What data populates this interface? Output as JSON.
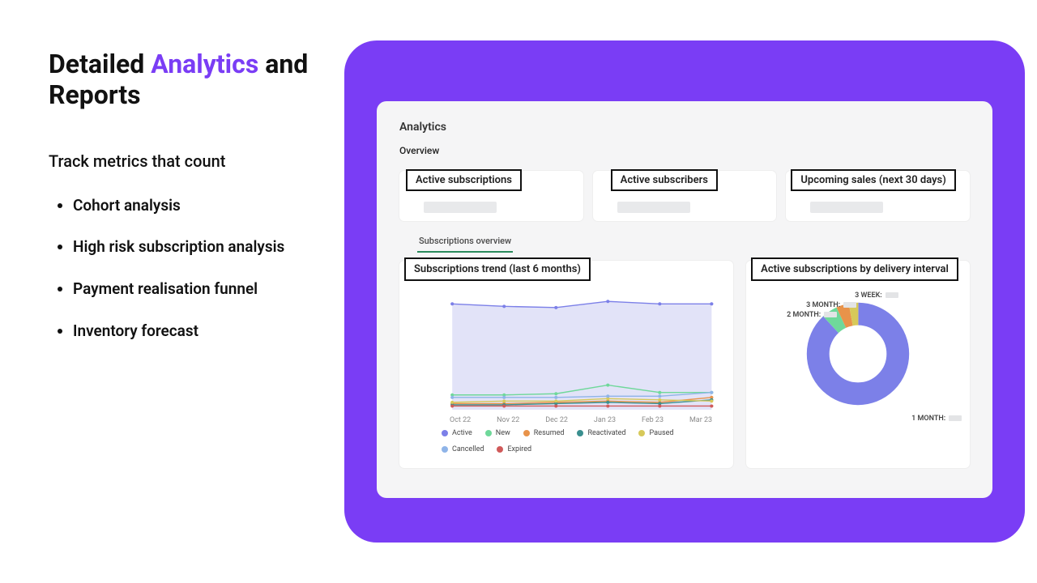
{
  "headline": {
    "pre": "Detailed ",
    "accent": "Analytics",
    "post": " and Reports"
  },
  "subhead": "Track metrics that count",
  "bullets": [
    "Cohort analysis",
    "High risk subscription analysis",
    "Payment realisation funnel",
    "Inventory forecast"
  ],
  "dashboard": {
    "title": "Analytics",
    "subtitle": "Overview",
    "kpis": [
      {
        "label": "Active subscriptions"
      },
      {
        "label": "Active subscribers"
      },
      {
        "label": "Upcoming sales (next 30 days)"
      }
    ],
    "tabs": {
      "active": "Subscriptions overview"
    },
    "trend_title": "Subscriptions trend (last 6 months)",
    "donut_title": "Active subscriptions by delivery interval"
  },
  "chart_data": [
    {
      "type": "line",
      "title": "Subscriptions trend (last 6 months)",
      "categories": [
        "Oct 22",
        "Nov 22",
        "Dec 22",
        "Jan 23",
        "Feb 23",
        "Mar 23"
      ],
      "ylim": [
        0,
        100
      ],
      "series": [
        {
          "name": "Active",
          "color": "#7c80e8",
          "values": [
            86,
            84,
            83,
            88,
            86,
            86
          ]
        },
        {
          "name": "New",
          "color": "#6fd89a",
          "values": [
            12,
            12,
            13,
            20,
            14,
            14
          ]
        },
        {
          "name": "Resumed",
          "color": "#e8934a",
          "values": [
            5,
            5,
            6,
            7,
            6,
            10
          ]
        },
        {
          "name": "Reactivated",
          "color": "#3a8f8f",
          "values": [
            4,
            4,
            5,
            6,
            5,
            8
          ]
        },
        {
          "name": "Paused",
          "color": "#d7c95a",
          "values": [
            6,
            7,
            7,
            9,
            8,
            7
          ]
        },
        {
          "name": "Cancelled",
          "color": "#8fb4e8",
          "values": [
            10,
            10,
            10,
            11,
            11,
            14
          ]
        },
        {
          "name": "Expired",
          "color": "#d05a5a",
          "values": [
            3,
            3,
            3,
            3,
            3,
            3
          ]
        }
      ]
    },
    {
      "type": "pie",
      "title": "Active subscriptions by delivery interval",
      "slices": [
        {
          "label": "1 MONTH:",
          "value": 88,
          "color": "#7c80e8"
        },
        {
          "label": "2 MONTH:",
          "value": 5,
          "color": "#6fd89a"
        },
        {
          "label": "3 MONTH:",
          "value": 4,
          "color": "#e8934a"
        },
        {
          "label": "3 WEEK:",
          "value": 3,
          "color": "#d7c95a"
        }
      ]
    }
  ]
}
